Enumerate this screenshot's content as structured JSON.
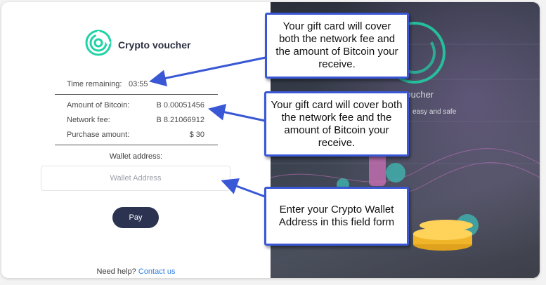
{
  "brand": {
    "title": "Crypto voucher",
    "logo_icon": "crypto-voucher-logo-icon",
    "accent": "#1fd3a6"
  },
  "summary": {
    "time_remaining_label": "Time remaining:",
    "time_remaining_value": "03:55",
    "rows": [
      {
        "label": "Amount of Bitcoin:",
        "value": "B 0.00051456"
      },
      {
        "label": "Network fee:",
        "value": "B 8.21066912"
      },
      {
        "label": "Purchase amount:",
        "value": "$ 30"
      }
    ]
  },
  "wallet": {
    "label": "Wallet address:",
    "placeholder": "Wallet Address",
    "value": ""
  },
  "pay_button": {
    "label": "Pay"
  },
  "help": {
    "text": "Need help?",
    "link": "Contact us",
    "link_color": "#2f7de0"
  },
  "promo": {
    "title": "Crypto voucher",
    "subtitle": "easy and safe"
  },
  "callouts": [
    {
      "text": "Your gift card will cover both the network fee and the amount of Bitcoin your receive."
    },
    {
      "text": "Your gift card will cover both the network fee and the amount of Bitcoin your receive."
    },
    {
      "text": "Enter your Crypto Wallet Address in this field form"
    }
  ],
  "colors": {
    "callout_border": "#3a57d6",
    "pay_button": "#2b3350",
    "promo_panel": "#39404d"
  }
}
